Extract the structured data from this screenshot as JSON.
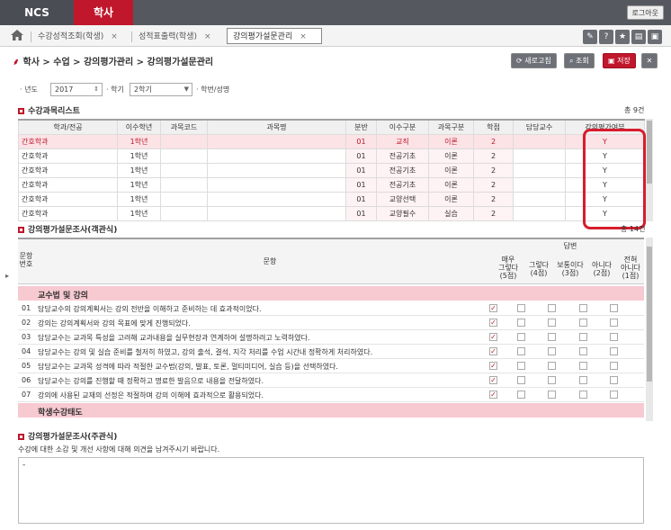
{
  "topbar": {
    "ncs": "NCS",
    "haksa": "학사",
    "logout": "로그아웃"
  },
  "tabs": [
    {
      "label": "수강성적조회(학생)"
    },
    {
      "label": "성적표출력(학생)"
    },
    {
      "label": "강의평가설문관리"
    }
  ],
  "tab_close": "×",
  "toolbar_icons": [
    "✎",
    "?",
    "★",
    "▤",
    "▣"
  ],
  "breadcrumb": "학사 > 수업 > 강의평가관리 > 강의평가설문관리",
  "actions": {
    "refresh": "새로고침",
    "search": "조회",
    "save": "저장",
    "close": "✕"
  },
  "filter": {
    "year_label": "· 년도",
    "year": "2017",
    "term_label": "· 학기",
    "term": "2학기",
    "student_label": "· 학번/성명"
  },
  "course_list": {
    "title": "수강과목리스트",
    "count": "총 9건",
    "columns": [
      "학과/전공",
      "이수학년",
      "과목코드",
      "과목명",
      "분반",
      "이수구분",
      "과목구분",
      "학점",
      "담당교수",
      "강의평가여부"
    ],
    "rows": [
      [
        "간호학과",
        "1학년",
        "",
        "",
        "01",
        "교직",
        "이론",
        "2",
        "",
        "Y"
      ],
      [
        "간호학과",
        "1학년",
        "",
        "",
        "01",
        "전공기초",
        "이론",
        "2",
        "",
        "Y"
      ],
      [
        "간호학과",
        "1학년",
        "",
        "",
        "01",
        "전공기초",
        "이론",
        "2",
        "",
        "Y"
      ],
      [
        "간호학과",
        "1학년",
        "",
        "",
        "01",
        "전공기초",
        "이론",
        "2",
        "",
        "Y"
      ],
      [
        "간호학과",
        "1학년",
        "",
        "",
        "01",
        "교양선택",
        "이론",
        "2",
        "",
        "Y"
      ],
      [
        "간호학과",
        "1학년",
        "",
        "",
        "01",
        "교양필수",
        "실습",
        "2",
        "",
        "Y"
      ]
    ]
  },
  "survey": {
    "title": "강의평가설문조사(객관식)",
    "count": "총 14건",
    "header": {
      "no": "문항\n번호",
      "question": "문항",
      "answer": "답변",
      "options": [
        "매우\n그렇다\n(5점)",
        "그렇다\n(4점)",
        "보통이다\n(3점)",
        "아니다\n(2점)",
        "전혀\n아니다\n(1점)"
      ]
    },
    "category1": "교수법 및 강의",
    "items": [
      {
        "no": "01",
        "q": "담당교수의 강의계획서는 강의 전반을 이해하고 준비하는 데 효과적이었다."
      },
      {
        "no": "02",
        "q": "강의는 강의계획서와 강의 목표에 맞게 진행되었다."
      },
      {
        "no": "03",
        "q": "담당교수는 교과목 특성을 고려해 교과내용을 실무현장과 연계하여 설명하려고 노력하였다."
      },
      {
        "no": "04",
        "q": "담당교수는 강의 및 실습 준비를 철저히 하였고, 강의 출석, 결석, 지각 처리를 수업 시간내 정확하게 처리하였다."
      },
      {
        "no": "05",
        "q": "담당교수는 교과목 성격에 따라 적절한 교수법(강의, 발표, 토론, 멀티미디어, 실습 등)을 선택하였다."
      },
      {
        "no": "06",
        "q": "담당교수는 강의를 진행할 때 정확하고 명료한 발음으로 내용을 전달하였다."
      },
      {
        "no": "07",
        "q": "강의에 사용된 교재의 선정은 적절하며 강의 이해에 효과적으로 활용되었다."
      }
    ],
    "check": "✓",
    "category2": "학생수강태도"
  },
  "comment": {
    "title": "강의평가설문조사(주관식)",
    "prompt": "수강에 대한 소감 및 개선 사항에 대해 의견을 남겨주시기 바랍니다.",
    "value": "-"
  }
}
